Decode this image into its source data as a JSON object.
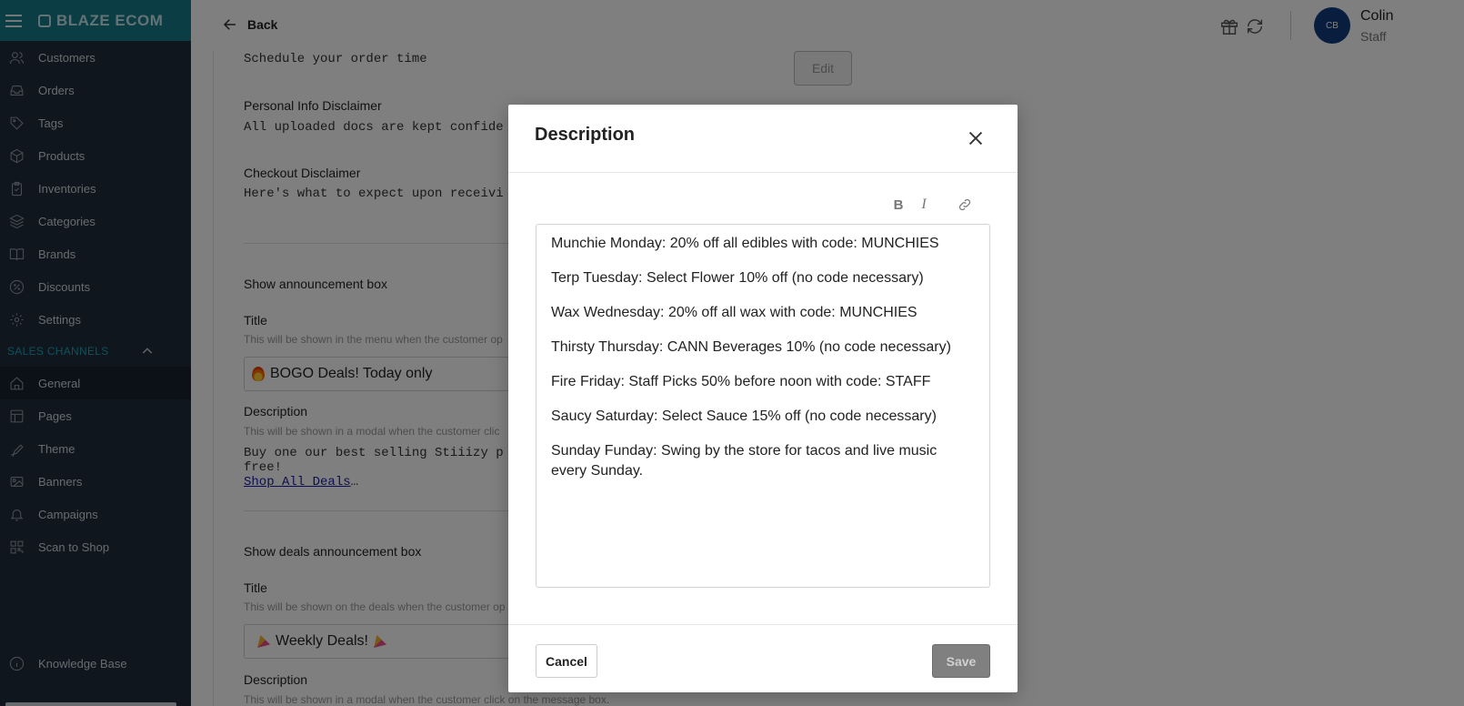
{
  "app": {
    "brand": "BLAZE ECOM"
  },
  "sidebar": {
    "items": [
      {
        "label": "Customers",
        "icon": "users-icon"
      },
      {
        "label": "Orders",
        "icon": "inbox-icon"
      },
      {
        "label": "Tags",
        "icon": "tag-icon"
      },
      {
        "label": "Products",
        "icon": "box-icon"
      },
      {
        "label": "Inventories",
        "icon": "clipboard-icon"
      },
      {
        "label": "Categories",
        "icon": "layers-icon"
      },
      {
        "label": "Brands",
        "icon": "book-icon"
      },
      {
        "label": "Discounts",
        "icon": "percent-icon"
      },
      {
        "label": "Settings",
        "icon": "gear-icon"
      }
    ],
    "section_label": "SALES CHANNELS",
    "channel_items": [
      {
        "label": "General",
        "icon": "home-icon",
        "active": true
      },
      {
        "label": "Pages",
        "icon": "layout-icon"
      },
      {
        "label": "Theme",
        "icon": "brush-icon"
      },
      {
        "label": "Banners",
        "icon": "banner-icon"
      },
      {
        "label": "Campaigns",
        "icon": "bell-icon"
      },
      {
        "label": "Scan to Shop",
        "icon": "qr-icon"
      }
    ],
    "knowledge_base": "Knowledge Base"
  },
  "header": {
    "back_label": "Back",
    "user_initials": "CB",
    "user_name": "Colin",
    "user_role": "Staff"
  },
  "content": {
    "schedule_text": "Schedule your order time",
    "edit_label": "Edit",
    "personal_label": "Personal Info Disclaimer",
    "personal_text": "All uploaded docs are kept confide",
    "checkout_label": "Checkout Disclaimer",
    "checkout_text": "Here's what to expect upon receivi",
    "announce_heading": "Show announcement box",
    "title_label": "Title",
    "announce_title_helper": "This will be shown in the menu when the customer op",
    "announce_title_value": "BOGO Deals! Today only",
    "description_label": "Description",
    "announce_desc_helper": "This will be shown in a modal when the customer clic",
    "announce_desc_line1": "Buy one our best selling Stiiizy p",
    "announce_desc_line2": "free!",
    "announce_desc_link": "Shop All Deals",
    "announce_desc_ellipsis": "…",
    "deals_heading": "Show deals announcement box",
    "deals_title_helper": "This will be shown on the deals when the customer op",
    "deals_title_value": "Weekly Deals!",
    "deals_desc_helper": "This will be shown in a modal when the customer click on the message box."
  },
  "modal": {
    "title": "Description",
    "toolbar": {
      "bold": "B",
      "italic": "I"
    },
    "paragraphs": [
      "Munchie Monday: 20% off all edibles with code: MUNCHIES",
      "Terp Tuesday: Select Flower 10% off (no code necessary)",
      "Wax Wednesday: 20% off all wax with code: MUNCHIES",
      "Thirsty Thursday: CANN Beverages 10% (no code necessary)",
      "Fire Friday: Staff Picks 50% before noon with code: STAFF",
      "Saucy Saturday: Select Sauce 15% off (no code necessary)",
      "Sunday Funday: Swing by the store for tacos and live music every Sunday."
    ],
    "cancel_label": "Cancel",
    "save_label": "Save"
  },
  "colors": {
    "brand_bar": "#167a8b",
    "sidebar_bg": "#1f2d3a",
    "section_label": "#1aa3b6",
    "avatar": "#123d7c",
    "save_disabled": "#808080"
  }
}
